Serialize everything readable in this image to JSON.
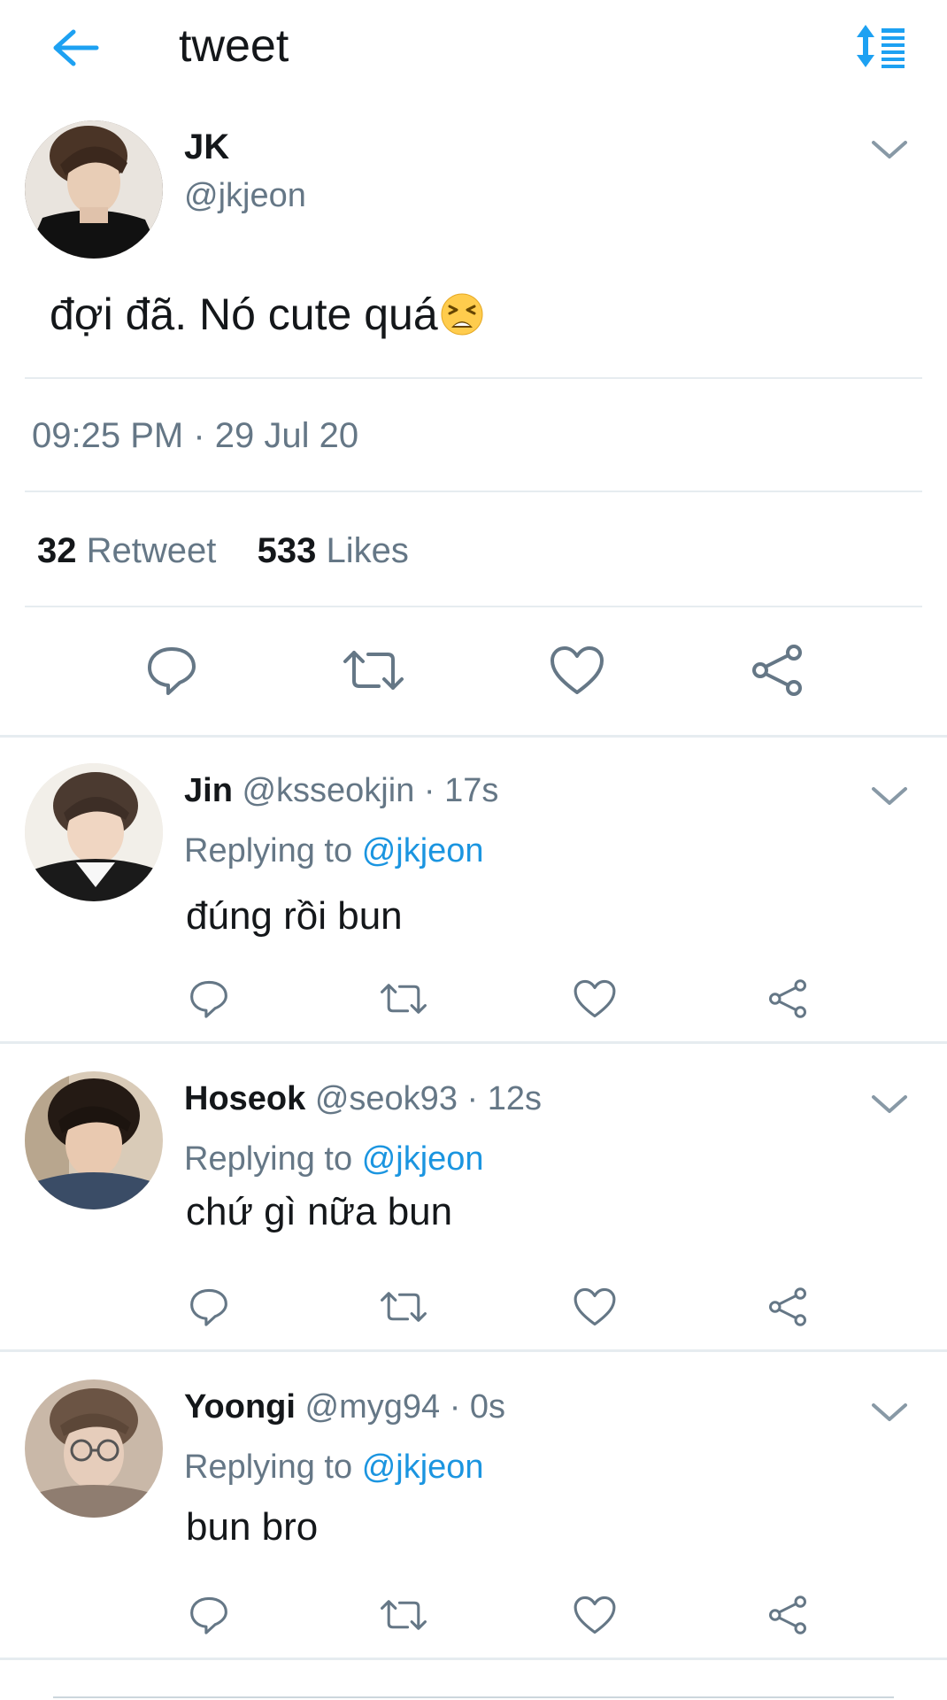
{
  "header": {
    "title": "tweet",
    "back_icon": "arrow-left-icon",
    "sort_icon": "sort-list-icon",
    "accent_color": "#1da1f2"
  },
  "tweet": {
    "name": "JK",
    "handle": "@jkjeon",
    "text": "đợi đã. Nó cute quá",
    "emoji": "tired-face-emoji",
    "timestamp": "09:25 PM · 29 Jul 20",
    "retweets_count": "32",
    "retweets_label": "Retweet",
    "likes_count": "533",
    "likes_label": "Likes"
  },
  "actions": [
    "reply-icon",
    "retweet-icon",
    "like-icon",
    "share-icon"
  ],
  "replies": [
    {
      "name": "Jin",
      "handle": "@ksseokjin",
      "time": "· 17s",
      "replying_label": "Replying to",
      "replying_to": "@jkjeon",
      "text": "đúng rồi bun"
    },
    {
      "name": "Hoseok",
      "handle": "@seok93",
      "time": "· 12s",
      "replying_label": "Replying to",
      "replying_to": "@jkjeon",
      "text": "chứ gì nữa bun"
    },
    {
      "name": "Yoongi",
      "handle": "@myg94",
      "time": "· 0s",
      "replying_label": "Replying to",
      "replying_to": "@jkjeon",
      "text": "bun bro"
    }
  ]
}
